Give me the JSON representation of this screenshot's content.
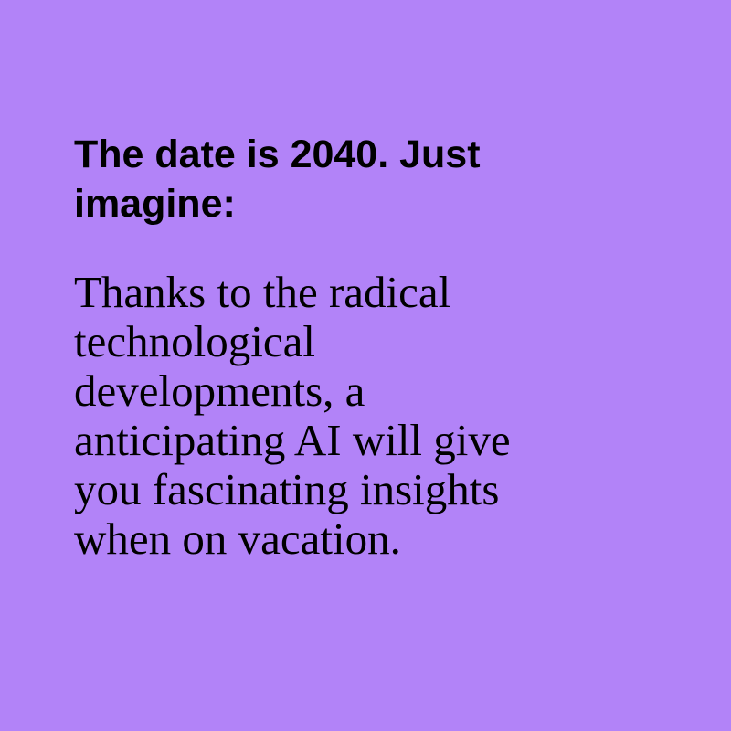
{
  "background_color": "#b283f8",
  "text_color": "#000000",
  "heading": {
    "lines": [
      "The date is 2040. Just",
      "imagine:"
    ]
  },
  "body": {
    "lines": [
      "Thanks to the radical",
      "technological",
      "developments, a",
      "anticipating AI will give",
      "you fascinating insights",
      "when on vacation."
    ]
  }
}
